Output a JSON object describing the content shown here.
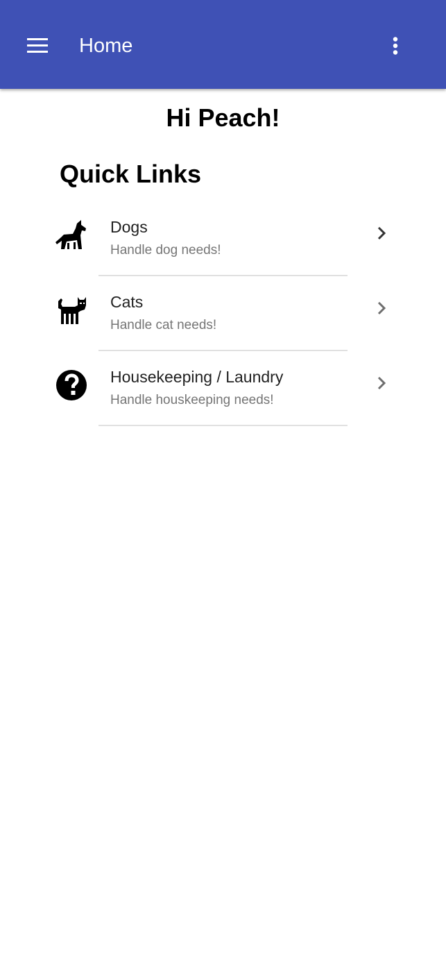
{
  "app_bar": {
    "title": "Home",
    "menu_icon": "hamburger-menu-icon",
    "overflow_icon": "more-vert-icon",
    "background_color": "#3f51b5"
  },
  "greeting": "Hi Peach!",
  "quick_links": {
    "title": "Quick Links",
    "items": [
      {
        "title": "Dogs",
        "subtitle": "Handle dog needs!",
        "icon": "dog-icon",
        "chevron_color": "#333333"
      },
      {
        "title": "Cats",
        "subtitle": "Handle cat needs!",
        "icon": "cat-icon",
        "chevron_color": "#6e6e6e"
      },
      {
        "title": "Housekeeping / Laundry",
        "subtitle": "Handle houskeeping needs!",
        "icon": "help-circle-icon",
        "chevron_color": "#6e6e6e"
      }
    ]
  }
}
